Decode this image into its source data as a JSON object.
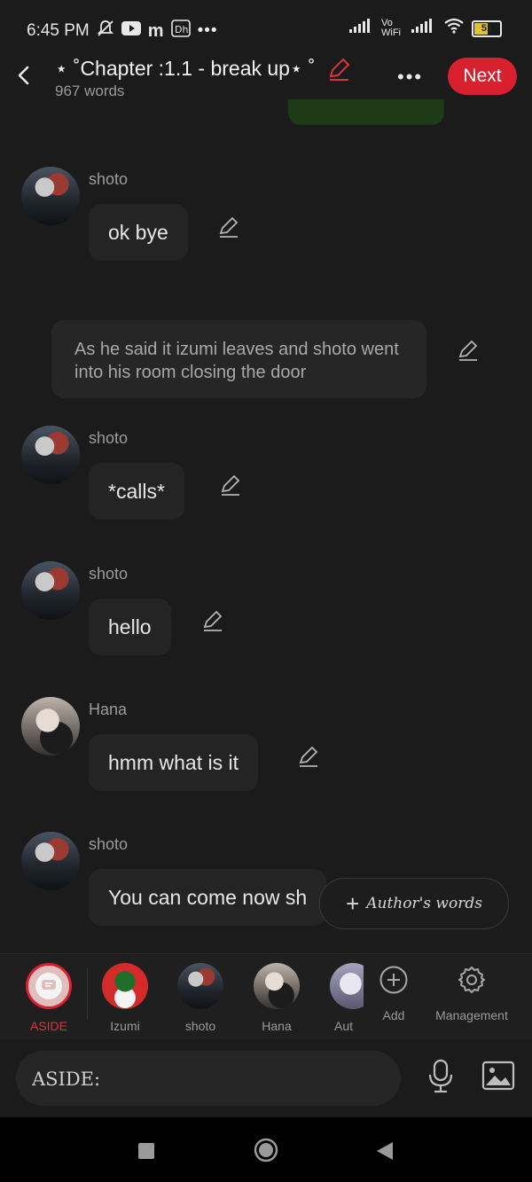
{
  "status_bar": {
    "time": "6:45 PM",
    "battery": "51",
    "network_label": "Vo WiFi"
  },
  "header": {
    "title": "⋆ ˚Chapter :1.1 - break up⋆ ˚",
    "word_count": "967 words",
    "next_label": "Next",
    "more_label": "•••"
  },
  "messages": [
    {
      "sender": "shoto",
      "text": "ok bye"
    },
    {
      "type": "narration",
      "text": "As he said it izumi leaves and shoto went into his room closing the door"
    },
    {
      "sender": "shoto",
      "text": "*calls*"
    },
    {
      "sender": "shoto",
      "text": "hello"
    },
    {
      "sender": "Hana",
      "text": "hmm what is it"
    },
    {
      "sender": "shoto",
      "text": "You can come now sh"
    }
  ],
  "authors_words_label": "Author's words",
  "characters": [
    {
      "label": "ASIDE"
    },
    {
      "label": "Izumi"
    },
    {
      "label": "shoto"
    },
    {
      "label": "Hana"
    },
    {
      "label": "Aut"
    }
  ],
  "tools": {
    "add_label": "Add",
    "management_label": "Management"
  },
  "input": {
    "placeholder": "ASIDE:"
  },
  "colors": {
    "accent": "#d8202e",
    "background": "#1b1b1b",
    "bubble": "#242424"
  }
}
